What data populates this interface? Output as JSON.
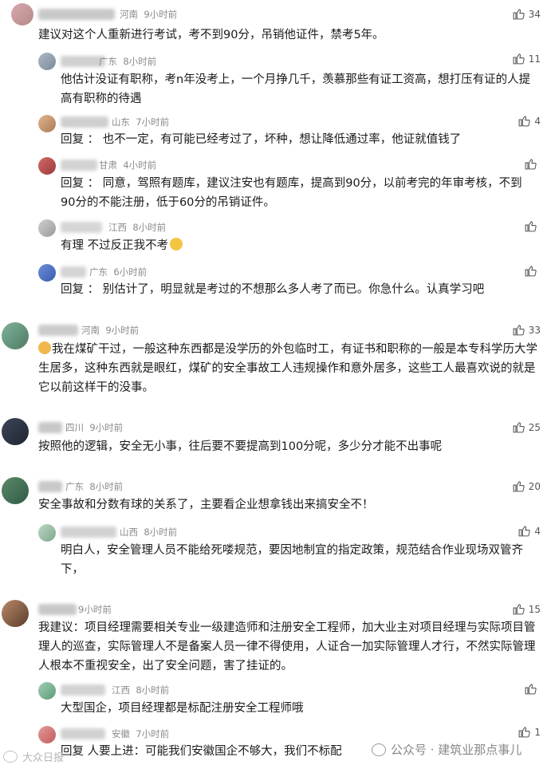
{
  "comments": [
    {
      "region": "河南",
      "time": "9小时前",
      "text": "建议对这个人重新进行考试，考不到90分，吊销他证件，禁考5年。",
      "likes": "34"
    },
    {
      "region": "广东",
      "time": "8小时前",
      "text": "他估计没证有职称，考n年没考上，一个月挣几千，羡慕那些有证工资高，想打压有证的人提高有职称的待遇",
      "likes": "11"
    },
    {
      "region": "山东",
      "time": "7小时前",
      "text": "回复 ： 也不一定，有可能已经考过了，坏种，想让降低通过率，他证就值钱了",
      "likes": "4"
    },
    {
      "region": "甘肃",
      "time": "4小时前",
      "text": "回复 ： 同意，驾照有题库，建议注安也有题库，提高到90分，以前考完的年审考核，不到90分的不能注册，低于60分的吊销证件。",
      "likes": ""
    },
    {
      "region": "江西",
      "time": "8小时前",
      "text": "有理 不过反正我不考",
      "likes": ""
    },
    {
      "region": "广东",
      "time": "6小时前",
      "text": "回复 ： 别估计了，明显就是考过的不想那么多人考了而已。你急什么。认真学习吧",
      "likes": ""
    },
    {
      "region": "河南",
      "time": "9小时前",
      "text": "我在煤矿干过，一般这种东西都是没学历的外包临时工，有证书和职称的一般是本专科学历大学生居多，这种东西就是眼红，煤矿的安全事故工人违规操作和意外居多，这些工人最喜欢说的就是它以前这样干的没事。",
      "likes": "33"
    },
    {
      "region": "四川",
      "time": "9小时前",
      "text": "按照他的逻辑，安全无小事，往后要不要提高到100分呢，多少分才能不出事呢",
      "likes": "25"
    },
    {
      "region": "广东",
      "time": "8小时前",
      "text": "安全事故和分数有球的关系了，主要看企业想拿钱出来搞安全不！",
      "likes": "20"
    },
    {
      "region": "山西",
      "time": "8小时前",
      "text": "明白人，安全管理人员不能给死喽规范，要因地制宜的指定政策，规范结合作业现场双管齐下，",
      "likes": "4"
    },
    {
      "region": "",
      "time": "9小时前",
      "text": "我建议：项目经理需要相关专业一级建造师和注册安全工程师，加大业主对项目经理与实际项目管理人的巡查，实际管理人不是备案人员一律不得使用，人证合一加实际管理人才行，不然实际管理人根本不重视安全，出了安全问题，害了挂证的。",
      "likes": "15"
    },
    {
      "region": "江西",
      "time": "8小时前",
      "text": "大型国企，项目经理都是标配注册安全工程师哦",
      "likes": ""
    },
    {
      "region": "安徽",
      "time": "7小时前",
      "text": "回复 人要上进：可能我们安徽国企不够大，我们不标配",
      "likes": "1"
    }
  ],
  "watermark": {
    "left": "大众日报",
    "right": "公众号 · 建筑业那点事儿"
  },
  "icons": {
    "like": "thumbs-up-icon"
  }
}
